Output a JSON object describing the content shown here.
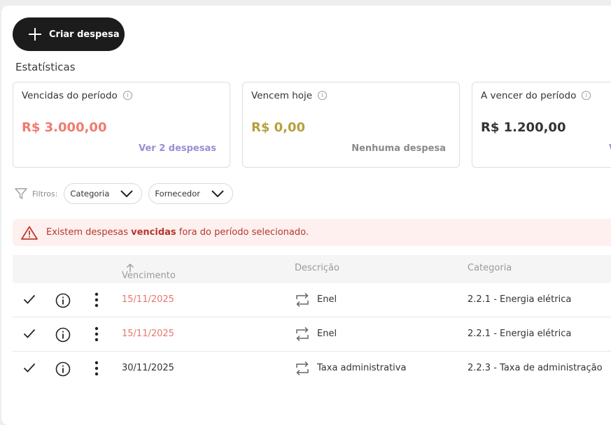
{
  "toolbar": {
    "create_label": "Criar despesa"
  },
  "stats": {
    "title": "Estatísticas",
    "cards": [
      {
        "title": "Vencidas do período",
        "value": "R$ 3.000,00",
        "link": "Ver 2 despesas",
        "value_color": "#ef7b6f",
        "link_color": "#9b8ed3"
      },
      {
        "title": "Vencem hoje",
        "value": "R$ 0,00",
        "link": "Nenhuma despesa",
        "value_color": "#b6a03e",
        "link_color": "#8a8a8a"
      },
      {
        "title": "A vencer do período",
        "value": "R$ 1.200,00",
        "link": "V",
        "value_color": "#333333",
        "link_color": "#9b8ed3"
      }
    ]
  },
  "filters": {
    "label": "Filtros:",
    "chips": [
      {
        "label": "Categoria"
      },
      {
        "label": "Fornecedor"
      }
    ]
  },
  "alert": {
    "prefix": "Existem despesas",
    "bold": "vencidas",
    "suffix": "fora do período selecionado."
  },
  "table": {
    "headers": {
      "due": "Vencimento",
      "desc": "Descrição",
      "cat": "Categoria"
    },
    "rows": [
      {
        "due": "15/11/2025",
        "overdue": true,
        "desc": "Enel",
        "cat": "2.2.1 - Energia elétrica"
      },
      {
        "due": "15/11/2025",
        "overdue": true,
        "desc": "Enel",
        "cat": "2.2.1 - Energia elétrica"
      },
      {
        "due": "30/11/2025",
        "overdue": false,
        "desc": "Taxa administrativa",
        "cat": "2.2.3 - Taxa de administração"
      }
    ]
  },
  "icons": {
    "create": "plus-icon",
    "info": "info-circle-icon",
    "filter": "funnel-icon",
    "chevron": "chevron-down-icon",
    "warning": "warning-triangle-icon",
    "sort": "arrow-up-icon",
    "check": "check-icon",
    "more": "more-vertical-icon",
    "recurring": "repeat-icon"
  },
  "colors": {
    "overdue": "#e8776f",
    "alert_text": "#b6362f",
    "alert_bg": "#fdf0ee",
    "primary_button": "#1c1c1c"
  }
}
